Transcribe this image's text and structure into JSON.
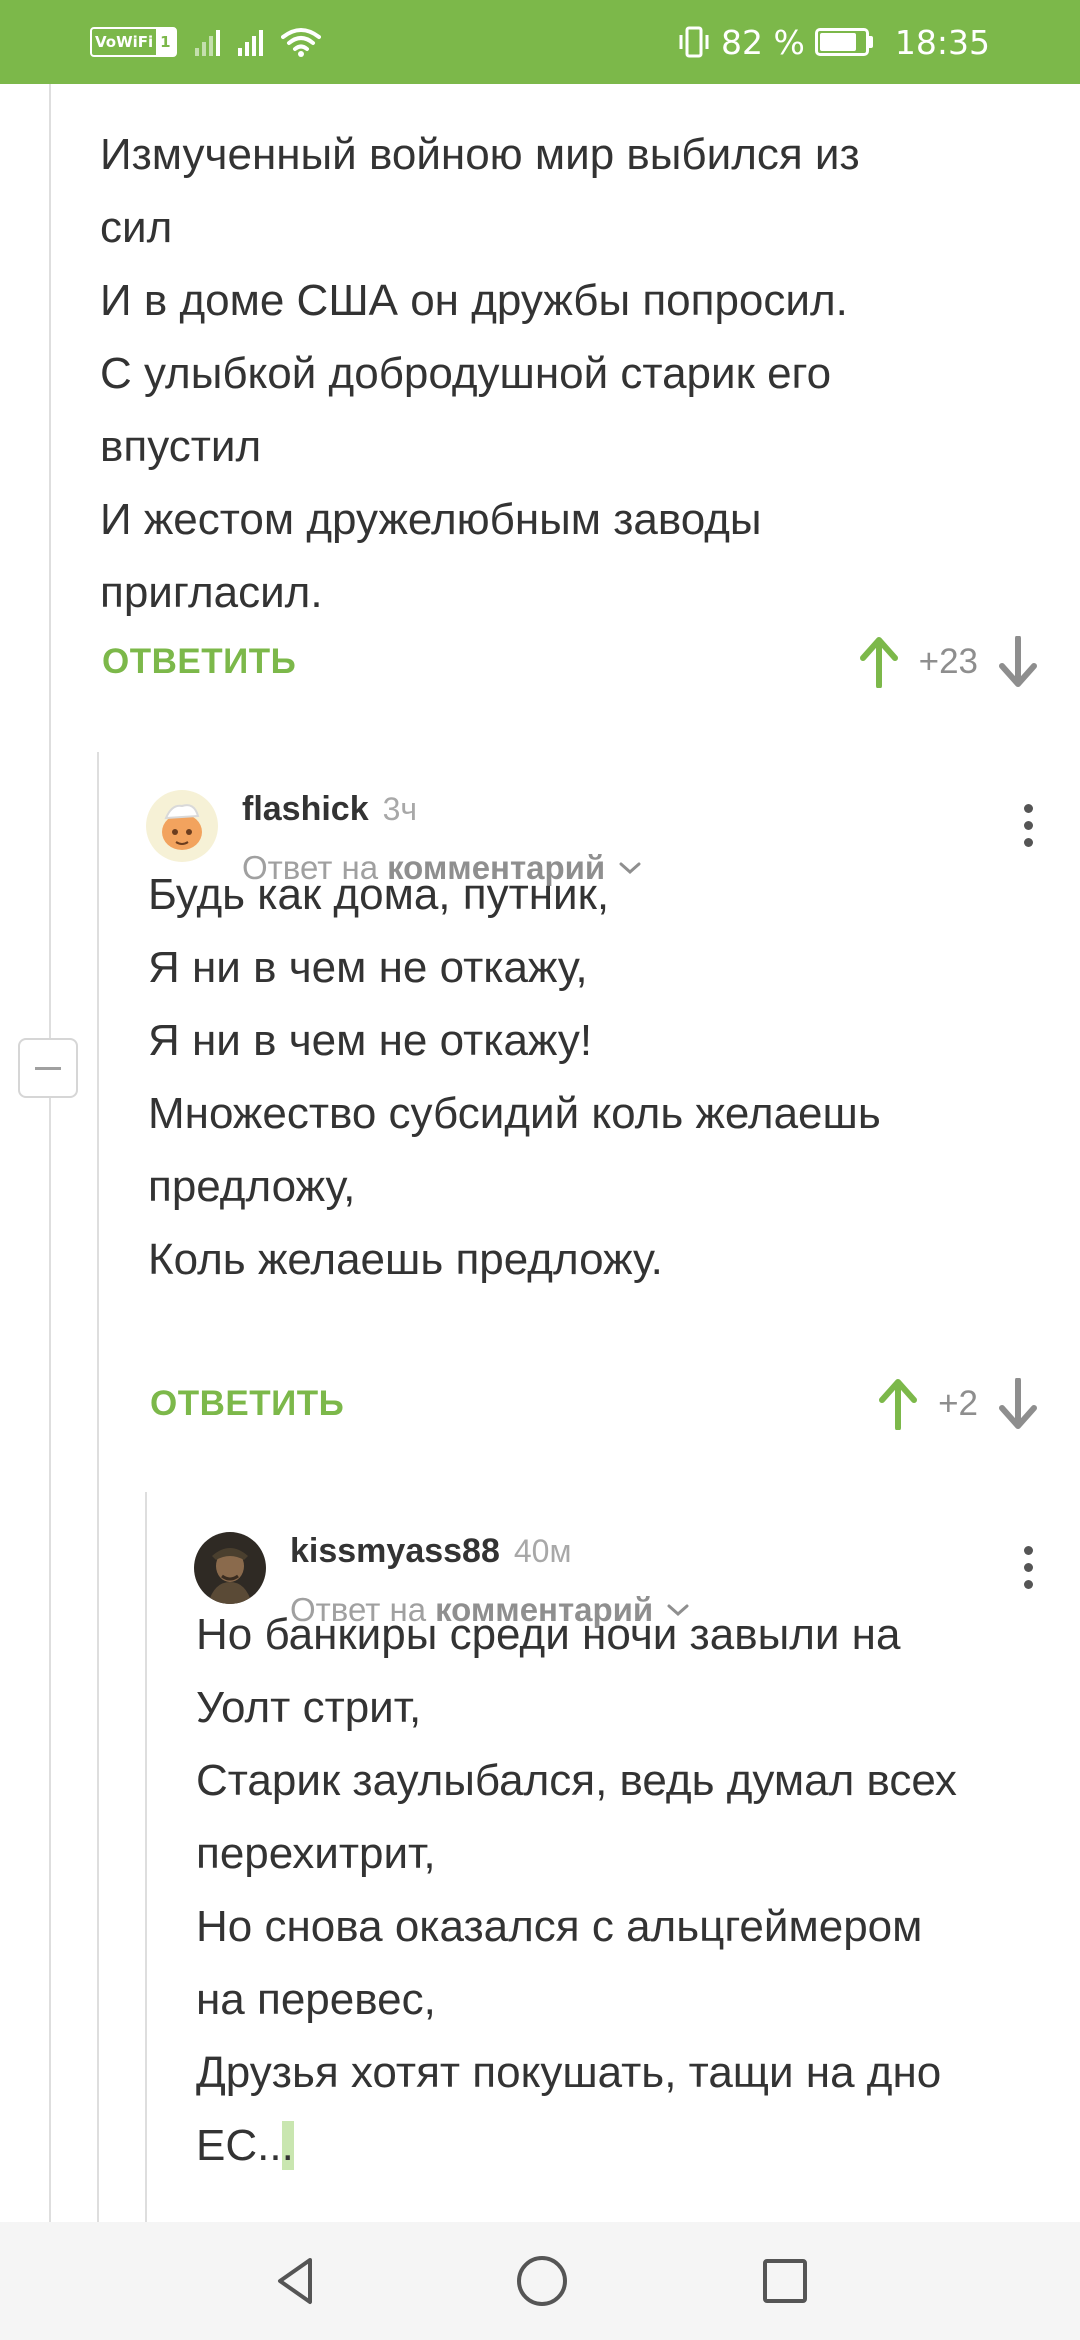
{
  "status_bar": {
    "vowifi_label": "VoWiFi",
    "sim_label": "1",
    "battery_percent": "82 %",
    "battery_level": 0.82,
    "time": "18:35",
    "icons": [
      "vowifi-icon",
      "signal-icon",
      "signal-icon",
      "wifi-icon",
      "vibrate-icon",
      "battery-icon"
    ]
  },
  "comments": [
    {
      "lines": [
        "Измученный войною мир выбился из",
        "сил",
        "И в доме США он дружбы попросил.",
        "С улыбкой добродушной старик его",
        "впустил",
        "И жестом дружелюбным заводы",
        "пригласил."
      ],
      "reply_label": "ОТВЕТИТЬ",
      "score": "+23"
    },
    {
      "username": "flashick",
      "time": "3ч",
      "reply_prefix": "Ответ на",
      "reply_target": "комментарий",
      "lines": [
        "Будь как дома, путник,",
        "Я ни в чем не откажу,",
        "Я ни в чем не откажу!",
        "Множество субсидий коль желаешь",
        "предложу,",
        "Коль желаешь предложу."
      ],
      "reply_label": "ОТВЕТИТЬ",
      "score": "+2"
    },
    {
      "username": "kissmyass88",
      "time": "40м",
      "reply_prefix": "Ответ на",
      "reply_target": "комментарий",
      "lines": [
        "Но банкиры среди ночи завыли на",
        "Уолт стрит,",
        "Старик заулыбался, ведь думал всех",
        "перехитрит,",
        "Но снова оказался с альцгеймером",
        "на перевес,",
        "Друзья хотят покушать, тащи на дно"
      ],
      "last_line_prefix": "ЕС..",
      "last_line_highlight": "."
    }
  ],
  "colors": {
    "accent": "#7cb84a",
    "text": "#333333",
    "muted": "#a0a0a0"
  }
}
